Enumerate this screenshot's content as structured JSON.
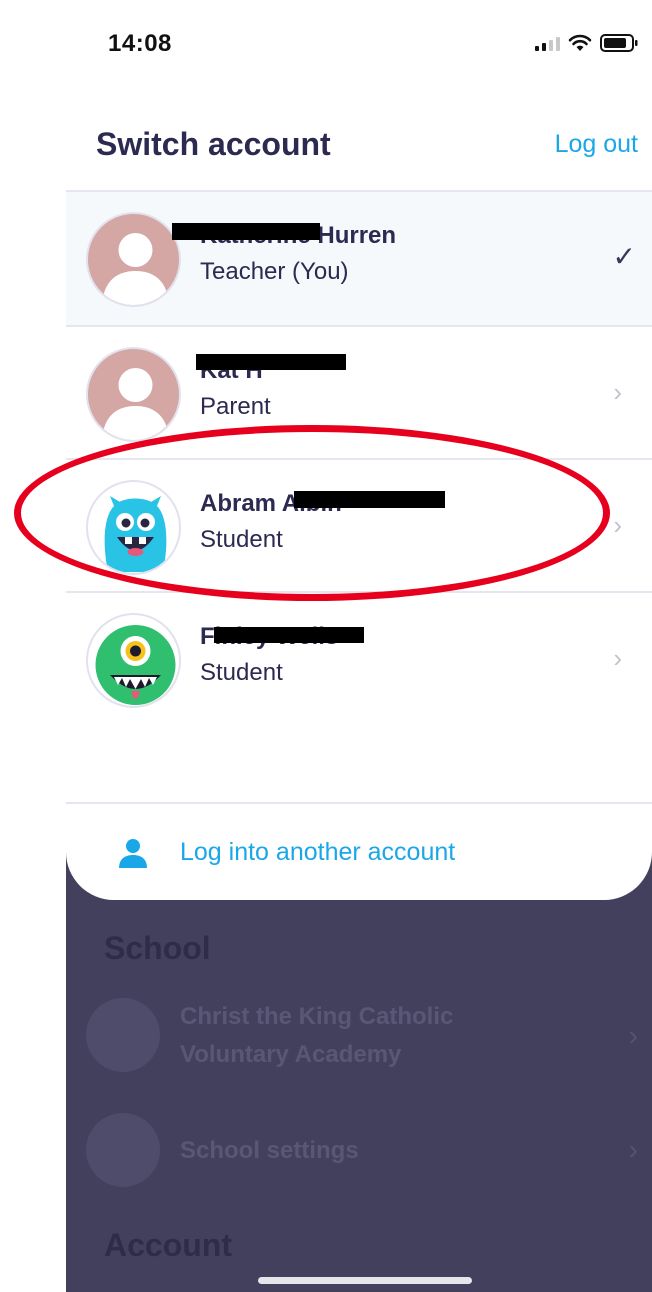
{
  "status_bar": {
    "time": "14:08"
  },
  "header": {
    "title": "Switch account",
    "logout_label": "Log out"
  },
  "accounts": [
    {
      "name": "Katherine Hurren",
      "role": "Teacher (You)",
      "selected": true
    },
    {
      "name": "Kat H",
      "role": "Parent",
      "selected": false
    },
    {
      "name": "Abram Albin",
      "role": "Student",
      "selected": false
    },
    {
      "name": "Finley Wells",
      "role": "Student",
      "selected": false
    }
  ],
  "login_other": {
    "label": "Log into another account"
  },
  "background": {
    "school_heading": "School",
    "school_name_line1": "Christ the King Catholic",
    "school_name_line2": "Voluntary Academy",
    "school_settings": "School settings",
    "account_heading": "Account"
  },
  "colors": {
    "accent": "#1aa7e8",
    "text": "#2c2a50",
    "annotation": "#e6001d",
    "dim_bg": "#43405e"
  }
}
